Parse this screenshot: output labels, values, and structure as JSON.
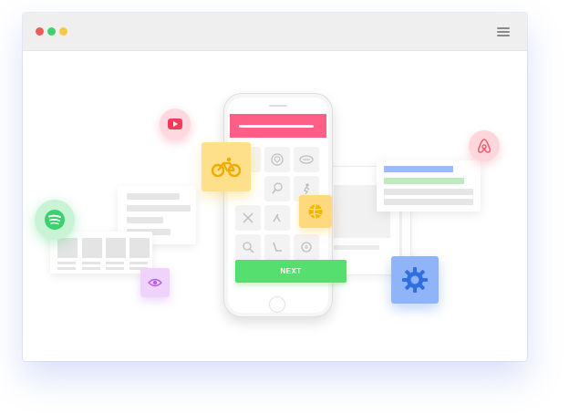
{
  "window": {
    "traffic_lights": [
      "#f05a5a",
      "#42cf6c",
      "#f7c843"
    ],
    "menu_icon": "hamburger-icon"
  },
  "phone": {
    "header_color": "#ff5f86",
    "grid_icons": [
      "bicycle-icon",
      "soccer-ball-icon",
      "football-icon",
      "ping-pong-icon",
      "running-icon",
      "crossed-swords-icon",
      "rugby-icon",
      "volleyball-icon",
      "magnifier-icon",
      "hockey-icon",
      "bowling-icon"
    ],
    "next_label": "NEXT",
    "next_color": "#55df6f"
  },
  "floating": {
    "cycling_tile_color": "#ffe08a",
    "volleyball_tile_color": "#ffd97d",
    "settings_tile_color": "#8fb5f8",
    "eye_tile_color": "#efd3fb",
    "youtube_color": "#f23d5c",
    "spotify_color": "#3bd16f",
    "airbnb_color": "#f25a73"
  },
  "icons": [
    "youtube-icon",
    "spotify-icon",
    "airbnb-icon",
    "bicycle-icon",
    "volleyball-icon",
    "gear-icon",
    "eye-icon"
  ]
}
